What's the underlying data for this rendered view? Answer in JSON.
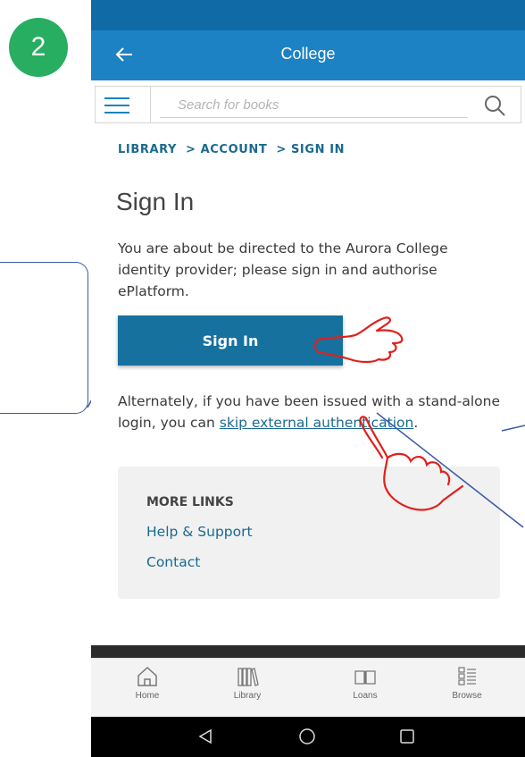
{
  "step": {
    "number": "2"
  },
  "app_bar": {
    "title": "College"
  },
  "search": {
    "placeholder": "Search for books"
  },
  "breadcrumb": {
    "items": [
      "LIBRARY",
      "> ACCOUNT",
      "> SIGN IN"
    ]
  },
  "page": {
    "title": "Sign In",
    "intro": "You are about be directed to the Aurora College identity provider; please sign in and authorise ePlatform.",
    "signin_label": "Sign In",
    "alt_text_before": "Alternately, if you have been issued with a stand-alone login, you can ",
    "alt_link": "skip external authentication",
    "alt_text_after": "."
  },
  "more_links": {
    "title": "MORE LINKS",
    "items": [
      "Help & Support",
      "Contact"
    ]
  },
  "bottom_nav": {
    "items": [
      "Home",
      "Library",
      "Loans",
      "Browse"
    ]
  },
  "colors": {
    "status_bar": "#0f6aa6",
    "app_bar": "#1c82c4",
    "primary_button": "#16719f",
    "link": "#1a6a8e",
    "step_badge": "#27ae60",
    "annotation_red": "#e0201c",
    "callout_blue": "#3b5aa8"
  }
}
